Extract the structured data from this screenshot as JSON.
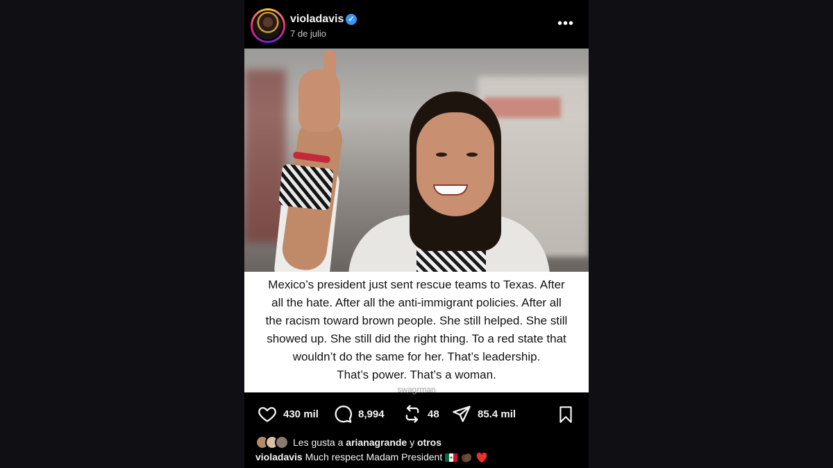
{
  "post": {
    "username": "violadavis",
    "date": "7 de julio",
    "more_label": "•••",
    "caption_lines": [
      "Mexico’s president just sent rescue teams to Texas. After",
      "all the hate. After all the anti-immigrant policies. After all",
      "the racism toward brown people. She still helped. She still",
      "showed up. She still did the right thing. To a red state that",
      "wouldn’t do the same for her. That’s leadership.",
      "That’s power. That’s a woman."
    ],
    "watermark": "swagrman"
  },
  "actions": {
    "likes": "430 mil",
    "comments": "8,994",
    "reposts": "48",
    "shares": "85.4 mil"
  },
  "liked_by": {
    "prefix": "Les gusta a",
    "user": "arianagrande",
    "conjunction": "y",
    "others": "otros"
  },
  "comment": {
    "user": "violadavis",
    "text": "Much respect Madam President"
  },
  "colors": {
    "verified": "#3897f0",
    "background": "#101014",
    "post_background": "#000000"
  }
}
